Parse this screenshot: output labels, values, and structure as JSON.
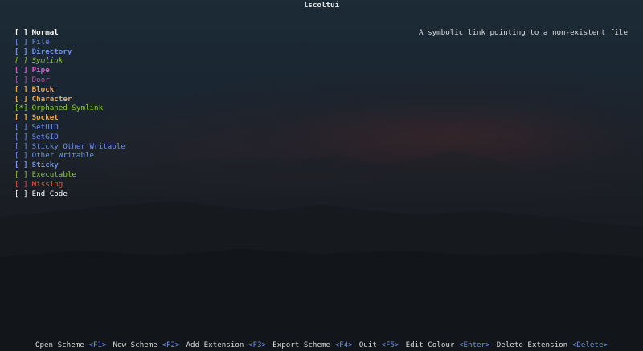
{
  "app": {
    "title": "lscoltui"
  },
  "description": "A symbolic link pointing to a non-existent file",
  "types": [
    {
      "checkbox": "[ ]",
      "label": "Normal",
      "color": "#ffffff",
      "style": "bold"
    },
    {
      "checkbox": "[ ]",
      "label": "File",
      "color": "#6b93e8",
      "style": "normal"
    },
    {
      "checkbox": "[ ]",
      "label": "Directory",
      "color": "#6b93e8",
      "style": "bold"
    },
    {
      "checkbox": "[ ]",
      "label": "Symlink",
      "color": "#8cc34a",
      "style": "italic"
    },
    {
      "checkbox": "[ ]",
      "label": "Pipe",
      "color": "#d45cc9",
      "style": "bold"
    },
    {
      "checkbox": "[ ]",
      "label": "Door",
      "color": "#b15aa8",
      "style": "normal"
    },
    {
      "checkbox": "[ ]",
      "label": "Block",
      "color": "#f0a850",
      "style": "bold"
    },
    {
      "checkbox": "[ ]",
      "label": "Character",
      "color": "#f0a850",
      "style": "bold"
    },
    {
      "checkbox": "[*]",
      "label": "Orphaned Symlink",
      "color": "#8cc34a",
      "style": "strike"
    },
    {
      "checkbox": "[ ]",
      "label": "Socket",
      "color": "#f0a850",
      "style": "bold"
    },
    {
      "checkbox": "[ ]",
      "label": "SetUID",
      "color": "#6b93e8",
      "style": "normal"
    },
    {
      "checkbox": "[ ]",
      "label": "SetGID",
      "color": "#6b93e8",
      "style": "normal"
    },
    {
      "checkbox": "[ ]",
      "label": "Sticky Other Writable",
      "color": "#6b93e8",
      "style": "normal"
    },
    {
      "checkbox": "[ ]",
      "label": "Other Writable",
      "color": "#6b93e8",
      "style": "normal"
    },
    {
      "checkbox": "[ ]",
      "label": "Sticky",
      "color": "#6b93e8",
      "style": "bold"
    },
    {
      "checkbox": "[ ]",
      "label": "Executable",
      "color": "#8cc34a",
      "style": "normal"
    },
    {
      "checkbox": "[ ]",
      "label": "Missing",
      "color": "#e0554a",
      "style": "normal"
    },
    {
      "checkbox": "[ ]",
      "label": "End Code",
      "color": "#ffffff",
      "style": "normal"
    }
  ],
  "footer": [
    {
      "label": "Open Scheme",
      "key": "<F1>"
    },
    {
      "label": "New Scheme",
      "key": "<F2>"
    },
    {
      "label": "Add Extension",
      "key": "<F3>"
    },
    {
      "label": "Export Scheme",
      "key": "<F4>"
    },
    {
      "label": "Quit",
      "key": "<F5>"
    },
    {
      "label": "Edit Colour",
      "key": "<Enter>"
    },
    {
      "label": "Delete Extension",
      "key": "<Delete>"
    }
  ]
}
